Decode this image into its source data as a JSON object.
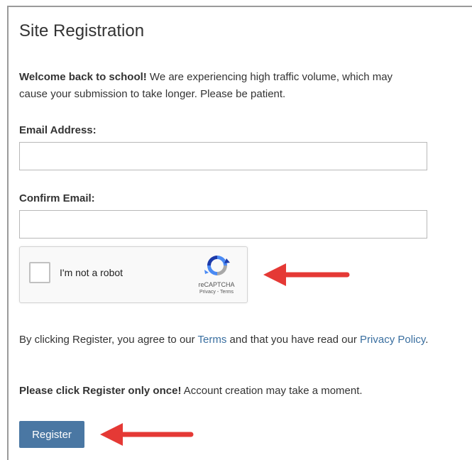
{
  "form": {
    "title": "Site Registration",
    "welcome_bold": "Welcome back to school!",
    "welcome_text": " We are experiencing high traffic volume, which may cause your submission to take longer. Please be patient.",
    "email_label": "Email Address:",
    "email_value": "",
    "confirm_label": "Confirm Email:",
    "confirm_value": ""
  },
  "captcha": {
    "label": "I'm not a robot",
    "brand": "reCAPTCHA",
    "links": "Privacy - Terms",
    "checked": false
  },
  "agreement": {
    "prefix": "By clicking Register, you agree to our ",
    "terms_link": "Terms",
    "middle": " and that you have read our ",
    "privacy_link": "Privacy Policy",
    "suffix": "."
  },
  "notice": {
    "bold": "Please click Register only once!",
    "text": " Account creation may take a moment."
  },
  "register_button": "Register",
  "colors": {
    "annotation_arrow": "#e53935",
    "button": "#4a77a3",
    "link": "#3a6fa0"
  },
  "annotations": {
    "arrow_icon": "red-arrow-left"
  }
}
